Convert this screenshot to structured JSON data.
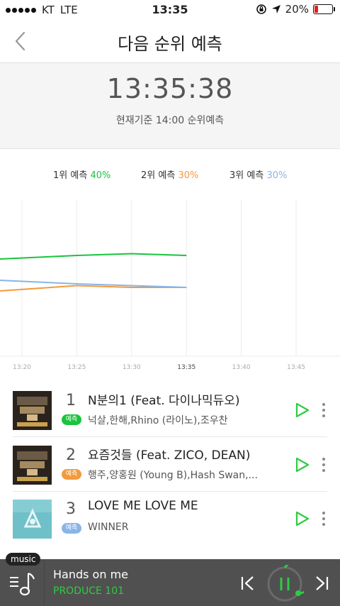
{
  "status_bar": {
    "carrier": "KT",
    "network": "LTE",
    "time": "13:35",
    "battery": "20%",
    "battery_level": 0.2
  },
  "header": {
    "title": "다음 순위 예측"
  },
  "countdown": {
    "time": "13:35:38",
    "basis": "현재기준 14:00 순위예측"
  },
  "legend": [
    {
      "label": "1위 예측",
      "value": "40%",
      "color": "#19c43c"
    },
    {
      "label": "2위 예측",
      "value": "30%",
      "color": "#f39a3c"
    },
    {
      "label": "3위 예측",
      "value": "30%",
      "color": "#8ab4e8"
    }
  ],
  "chart_data": {
    "type": "line",
    "x": [
      "13:20",
      "13:25",
      "13:30",
      "13:35",
      "13:40",
      "13:45"
    ],
    "xlim": [
      "13:18",
      "13:49"
    ],
    "ylim": [
      0,
      100
    ],
    "grid": "vertical",
    "series": [
      {
        "color": "#19c43c",
        "points": [
          [
            "13:18",
            40
          ],
          [
            "13:25",
            41
          ],
          [
            "13:30",
            41.5
          ],
          [
            "13:35",
            41
          ]
        ]
      },
      {
        "color": "#f39a3c",
        "points": [
          [
            "13:18",
            31
          ],
          [
            "13:25",
            32.5
          ],
          [
            "13:30",
            32
          ],
          [
            "13:35",
            32
          ]
        ]
      },
      {
        "color": "#8ab4e8",
        "points": [
          [
            "13:18",
            34
          ],
          [
            "13:25",
            33
          ],
          [
            "13:30",
            32.5
          ],
          [
            "13:35",
            32
          ]
        ]
      }
    ]
  },
  "songs": [
    {
      "rank": "1",
      "badge": "예측",
      "badge_color": "#19c43c",
      "title": "N분의1 (Feat. 다이나믹듀오)",
      "artist": "넉살,한해,Rhino (라이노),조우찬"
    },
    {
      "rank": "2",
      "badge": "예측",
      "badge_color": "#f39a3c",
      "title": "요즘것들 (Feat. ZICO, DEAN)",
      "artist": "행주,양홍원 (Young B),Hash Swan,..."
    },
    {
      "rank": "3",
      "badge": "예측",
      "badge_color": "#8ab4e8",
      "title": "LOVE ME LOVE ME",
      "artist": "WINNER"
    }
  ],
  "player": {
    "tag": "music",
    "title": "Hands on me",
    "artist": "PRODUCE 101",
    "accent": "#2ecc40"
  }
}
